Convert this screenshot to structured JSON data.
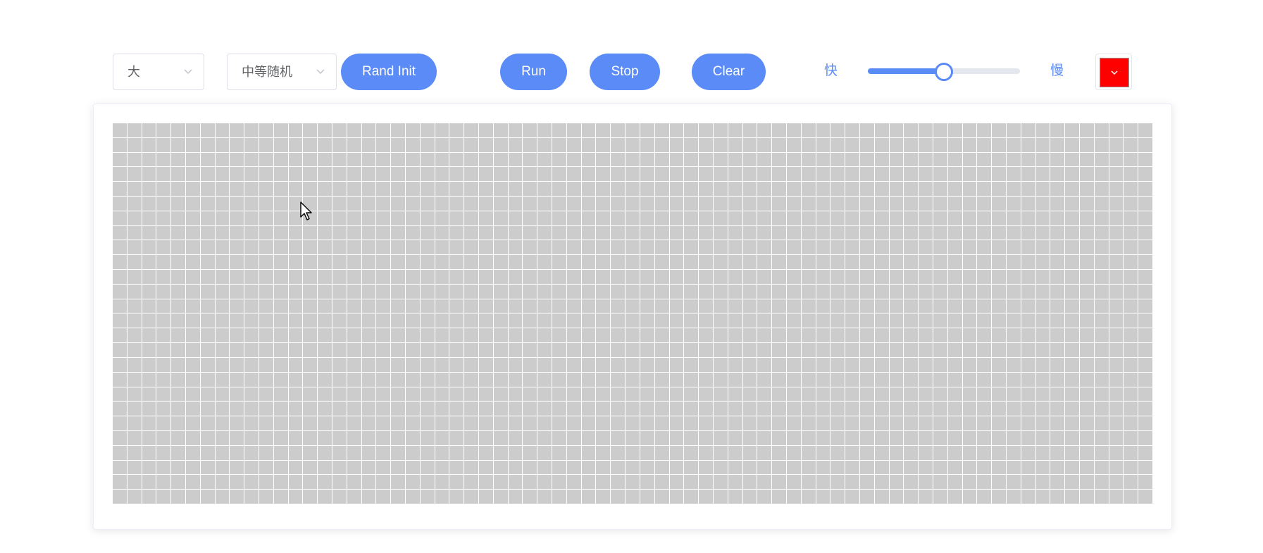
{
  "controls": {
    "size_select": {
      "value": "大"
    },
    "density_select": {
      "value": "中等随机"
    },
    "rand_init_label": "Rand Init",
    "run_label": "Run",
    "stop_label": "Stop",
    "clear_label": "Clear",
    "speed": {
      "fast_label": "快",
      "slow_label": "慢",
      "value_fraction": 0.5
    },
    "color_picker": {
      "value": "#ff0000"
    }
  },
  "board": {
    "rows": 26,
    "cols": 71,
    "cell_color": "#cccccc",
    "gap_color": "#ffffff"
  },
  "colors": {
    "accent": "#5a8bf7"
  }
}
